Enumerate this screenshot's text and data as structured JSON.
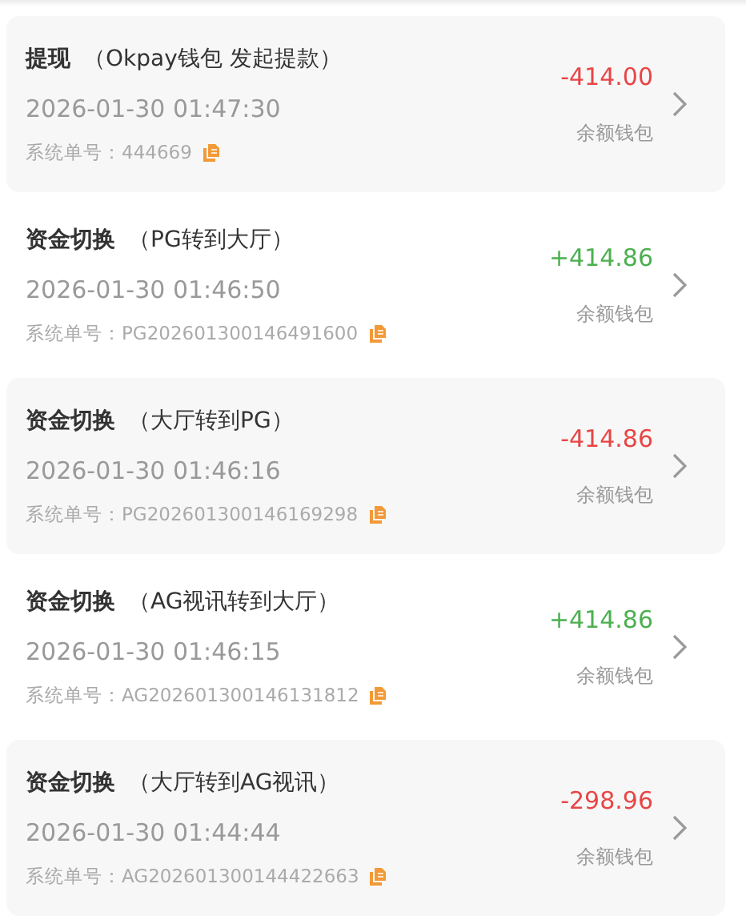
{
  "records": [
    {
      "type": "提现",
      "note": "（Okpay钱包 发起提款）",
      "time": "2026-01-30 01:47:30",
      "order_label": "系统单号：",
      "order_no": "444669",
      "amount": "-414.00",
      "kind": "debit",
      "wallet": "余额钱包"
    },
    {
      "type": "资金切换",
      "note": "（PG转到大厅）",
      "time": "2026-01-30 01:46:50",
      "order_label": "系统单号：",
      "order_no": "PG202601300146491600",
      "amount": "+414.86",
      "kind": "credit",
      "wallet": "余额钱包"
    },
    {
      "type": "资金切换",
      "note": "（大厅转到PG）",
      "time": "2026-01-30 01:46:16",
      "order_label": "系统单号：",
      "order_no": "PG202601300146169298",
      "amount": "-414.86",
      "kind": "debit",
      "wallet": "余额钱包"
    },
    {
      "type": "资金切换",
      "note": "（AG视讯转到大厅）",
      "time": "2026-01-30 01:46:15",
      "order_label": "系统单号：",
      "order_no": "AG202601300146131812",
      "amount": "+414.86",
      "kind": "credit",
      "wallet": "余额钱包"
    },
    {
      "type": "资金切换",
      "note": "（大厅转到AG视讯）",
      "time": "2026-01-30 01:44:44",
      "order_label": "系统单号：",
      "order_no": "AG202601300144422663",
      "amount": "-298.96",
      "kind": "debit",
      "wallet": "余额钱包"
    }
  ]
}
